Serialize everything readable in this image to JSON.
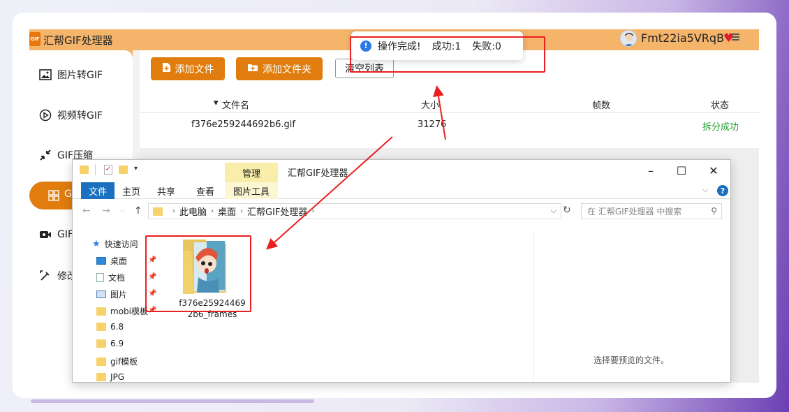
{
  "app": {
    "logo": "GIF",
    "title": "汇帮GIF处理器",
    "username": "Fmt22ia5VRqB"
  },
  "sidebar": {
    "items": [
      {
        "label": "图片转GIF",
        "icon": "image-icon"
      },
      {
        "label": "视频转GIF",
        "icon": "play-icon"
      },
      {
        "label": "GIF压缩",
        "icon": "compress-icon"
      },
      {
        "label": "G",
        "icon": "grid-icon"
      },
      {
        "label": "GIF",
        "icon": "camera-icon"
      },
      {
        "label": "修改",
        "icon": "edit-icon"
      }
    ]
  },
  "toolbar": {
    "add_file": "添加文件",
    "add_folder": "添加文件夹",
    "clear_list": "清空列表"
  },
  "table": {
    "columns": [
      "文件名",
      "大小",
      "帧数",
      "状态"
    ],
    "rows": [
      {
        "name": "f376e259244692b6.gif",
        "size": "31276",
        "frames": "",
        "status": "拆分成功"
      }
    ]
  },
  "toast": {
    "message": "操作完成!",
    "success": "成功:1",
    "fail": "失败:0"
  },
  "explorer": {
    "manage_tab": "管理",
    "window_title": "汇帮GIF处理器",
    "ribbon_tabs": [
      "文件",
      "主页",
      "共享",
      "查看",
      "图片工具"
    ],
    "breadcrumb": [
      "此电脑",
      "桌面",
      "汇帮GIF处理器"
    ],
    "search_placeholder": "在 汇帮GIF处理器 中搜索",
    "nav": {
      "quick_access": "快速访问",
      "items": [
        "桌面",
        "文档",
        "图片",
        "mobi模板",
        "6.8",
        "6.9",
        "gif模板",
        "JPG"
      ]
    },
    "file": {
      "name_line1": "f376e25924469",
      "name_line2": "2b6_frames"
    },
    "preview_hint": "选择要预览的文件。"
  },
  "colors": {
    "accent_orange": "#e07d0e",
    "titlebar_orange": "#f4b56b",
    "success_green": "#1f9d2c",
    "annotation_red": "#e8201f",
    "explorer_blue": "#1a6fbf"
  }
}
